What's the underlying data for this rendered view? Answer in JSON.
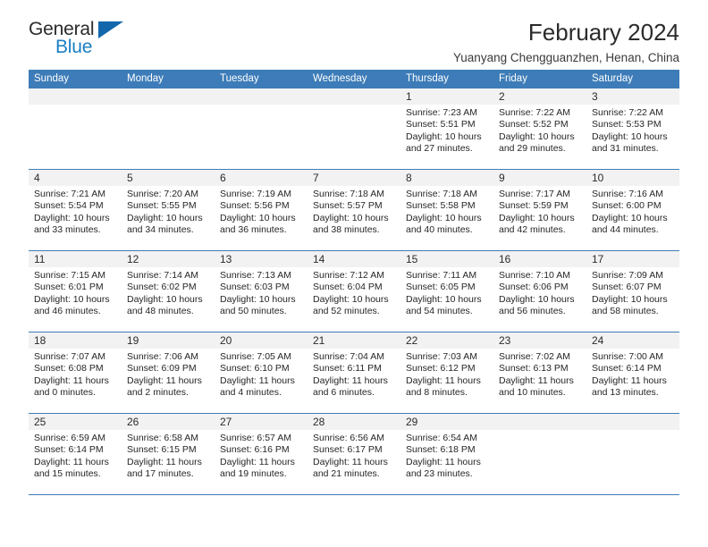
{
  "logo": {
    "word_top": "General",
    "word_bottom": "Blue",
    "triangle_color": "#1266ab",
    "blue_color": "#1b7fc4"
  },
  "header": {
    "title": "February 2024",
    "subtitle": "Yuanyang Chengguanzhen, Henan, China"
  },
  "theme": {
    "header_blue": "#3d7cb8",
    "band_gray": "#f2f2f2",
    "text": "#262626"
  },
  "weekdays": [
    "Sunday",
    "Monday",
    "Tuesday",
    "Wednesday",
    "Thursday",
    "Friday",
    "Saturday"
  ],
  "weeks": [
    [
      {
        "day": "",
        "empty": true
      },
      {
        "day": "",
        "empty": true
      },
      {
        "day": "",
        "empty": true
      },
      {
        "day": "",
        "empty": true
      },
      {
        "day": "1",
        "sunrise": "Sunrise: 7:23 AM",
        "sunset": "Sunset: 5:51 PM",
        "daylight1": "Daylight: 10 hours",
        "daylight2": "and 27 minutes."
      },
      {
        "day": "2",
        "sunrise": "Sunrise: 7:22 AM",
        "sunset": "Sunset: 5:52 PM",
        "daylight1": "Daylight: 10 hours",
        "daylight2": "and 29 minutes."
      },
      {
        "day": "3",
        "sunrise": "Sunrise: 7:22 AM",
        "sunset": "Sunset: 5:53 PM",
        "daylight1": "Daylight: 10 hours",
        "daylight2": "and 31 minutes."
      }
    ],
    [
      {
        "day": "4",
        "sunrise": "Sunrise: 7:21 AM",
        "sunset": "Sunset: 5:54 PM",
        "daylight1": "Daylight: 10 hours",
        "daylight2": "and 33 minutes."
      },
      {
        "day": "5",
        "sunrise": "Sunrise: 7:20 AM",
        "sunset": "Sunset: 5:55 PM",
        "daylight1": "Daylight: 10 hours",
        "daylight2": "and 34 minutes."
      },
      {
        "day": "6",
        "sunrise": "Sunrise: 7:19 AM",
        "sunset": "Sunset: 5:56 PM",
        "daylight1": "Daylight: 10 hours",
        "daylight2": "and 36 minutes."
      },
      {
        "day": "7",
        "sunrise": "Sunrise: 7:18 AM",
        "sunset": "Sunset: 5:57 PM",
        "daylight1": "Daylight: 10 hours",
        "daylight2": "and 38 minutes."
      },
      {
        "day": "8",
        "sunrise": "Sunrise: 7:18 AM",
        "sunset": "Sunset: 5:58 PM",
        "daylight1": "Daylight: 10 hours",
        "daylight2": "and 40 minutes."
      },
      {
        "day": "9",
        "sunrise": "Sunrise: 7:17 AM",
        "sunset": "Sunset: 5:59 PM",
        "daylight1": "Daylight: 10 hours",
        "daylight2": "and 42 minutes."
      },
      {
        "day": "10",
        "sunrise": "Sunrise: 7:16 AM",
        "sunset": "Sunset: 6:00 PM",
        "daylight1": "Daylight: 10 hours",
        "daylight2": "and 44 minutes."
      }
    ],
    [
      {
        "day": "11",
        "sunrise": "Sunrise: 7:15 AM",
        "sunset": "Sunset: 6:01 PM",
        "daylight1": "Daylight: 10 hours",
        "daylight2": "and 46 minutes."
      },
      {
        "day": "12",
        "sunrise": "Sunrise: 7:14 AM",
        "sunset": "Sunset: 6:02 PM",
        "daylight1": "Daylight: 10 hours",
        "daylight2": "and 48 minutes."
      },
      {
        "day": "13",
        "sunrise": "Sunrise: 7:13 AM",
        "sunset": "Sunset: 6:03 PM",
        "daylight1": "Daylight: 10 hours",
        "daylight2": "and 50 minutes."
      },
      {
        "day": "14",
        "sunrise": "Sunrise: 7:12 AM",
        "sunset": "Sunset: 6:04 PM",
        "daylight1": "Daylight: 10 hours",
        "daylight2": "and 52 minutes."
      },
      {
        "day": "15",
        "sunrise": "Sunrise: 7:11 AM",
        "sunset": "Sunset: 6:05 PM",
        "daylight1": "Daylight: 10 hours",
        "daylight2": "and 54 minutes."
      },
      {
        "day": "16",
        "sunrise": "Sunrise: 7:10 AM",
        "sunset": "Sunset: 6:06 PM",
        "daylight1": "Daylight: 10 hours",
        "daylight2": "and 56 minutes."
      },
      {
        "day": "17",
        "sunrise": "Sunrise: 7:09 AM",
        "sunset": "Sunset: 6:07 PM",
        "daylight1": "Daylight: 10 hours",
        "daylight2": "and 58 minutes."
      }
    ],
    [
      {
        "day": "18",
        "sunrise": "Sunrise: 7:07 AM",
        "sunset": "Sunset: 6:08 PM",
        "daylight1": "Daylight: 11 hours",
        "daylight2": "and 0 minutes."
      },
      {
        "day": "19",
        "sunrise": "Sunrise: 7:06 AM",
        "sunset": "Sunset: 6:09 PM",
        "daylight1": "Daylight: 11 hours",
        "daylight2": "and 2 minutes."
      },
      {
        "day": "20",
        "sunrise": "Sunrise: 7:05 AM",
        "sunset": "Sunset: 6:10 PM",
        "daylight1": "Daylight: 11 hours",
        "daylight2": "and 4 minutes."
      },
      {
        "day": "21",
        "sunrise": "Sunrise: 7:04 AM",
        "sunset": "Sunset: 6:11 PM",
        "daylight1": "Daylight: 11 hours",
        "daylight2": "and 6 minutes."
      },
      {
        "day": "22",
        "sunrise": "Sunrise: 7:03 AM",
        "sunset": "Sunset: 6:12 PM",
        "daylight1": "Daylight: 11 hours",
        "daylight2": "and 8 minutes."
      },
      {
        "day": "23",
        "sunrise": "Sunrise: 7:02 AM",
        "sunset": "Sunset: 6:13 PM",
        "daylight1": "Daylight: 11 hours",
        "daylight2": "and 10 minutes."
      },
      {
        "day": "24",
        "sunrise": "Sunrise: 7:00 AM",
        "sunset": "Sunset: 6:14 PM",
        "daylight1": "Daylight: 11 hours",
        "daylight2": "and 13 minutes."
      }
    ],
    [
      {
        "day": "25",
        "sunrise": "Sunrise: 6:59 AM",
        "sunset": "Sunset: 6:14 PM",
        "daylight1": "Daylight: 11 hours",
        "daylight2": "and 15 minutes."
      },
      {
        "day": "26",
        "sunrise": "Sunrise: 6:58 AM",
        "sunset": "Sunset: 6:15 PM",
        "daylight1": "Daylight: 11 hours",
        "daylight2": "and 17 minutes."
      },
      {
        "day": "27",
        "sunrise": "Sunrise: 6:57 AM",
        "sunset": "Sunset: 6:16 PM",
        "daylight1": "Daylight: 11 hours",
        "daylight2": "and 19 minutes."
      },
      {
        "day": "28",
        "sunrise": "Sunrise: 6:56 AM",
        "sunset": "Sunset: 6:17 PM",
        "daylight1": "Daylight: 11 hours",
        "daylight2": "and 21 minutes."
      },
      {
        "day": "29",
        "sunrise": "Sunrise: 6:54 AM",
        "sunset": "Sunset: 6:18 PM",
        "daylight1": "Daylight: 11 hours",
        "daylight2": "and 23 minutes."
      },
      {
        "day": "",
        "empty": true
      },
      {
        "day": "",
        "empty": true
      }
    ]
  ]
}
